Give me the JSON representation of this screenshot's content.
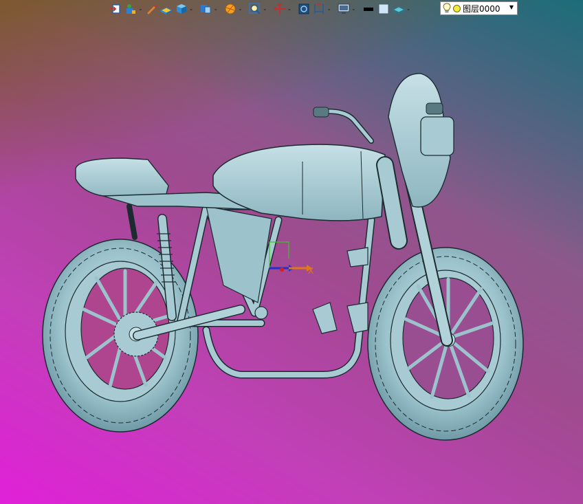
{
  "toolbar": {
    "buttons": [
      {
        "name": "import-icon",
        "dropdown": false
      },
      {
        "name": "plugin-icon",
        "dropdown": true
      },
      {
        "name": "sketch-pen-icon",
        "dropdown": false
      },
      {
        "name": "surface-icon",
        "dropdown": false
      },
      {
        "name": "solid-box-icon",
        "dropdown": true
      },
      {
        "name": "view-cube-icon",
        "dropdown": true
      },
      {
        "name": "render-sphere-icon",
        "dropdown": true
      },
      {
        "name": "zoom-icon",
        "dropdown": true
      },
      {
        "name": "pan-icon",
        "dropdown": true
      },
      {
        "name": "view-orient-icon",
        "dropdown": false
      },
      {
        "name": "dimension-icon",
        "dropdown": true
      },
      {
        "name": "display-monitor-icon",
        "dropdown": true
      },
      {
        "name": "line-color-swatch",
        "dropdown": false
      },
      {
        "name": "fill-color-swatch",
        "dropdown": false
      },
      {
        "name": "layer-stack-icon",
        "dropdown": true
      }
    ],
    "colors": {
      "line_swatch": "#000000",
      "fill_swatch": "#cfe6f7"
    }
  },
  "layer": {
    "current": "图层0000",
    "bulb_color": "#f4ea3c"
  },
  "viewport": {
    "model_color": "#9cc3cc",
    "axis_label": "X"
  }
}
